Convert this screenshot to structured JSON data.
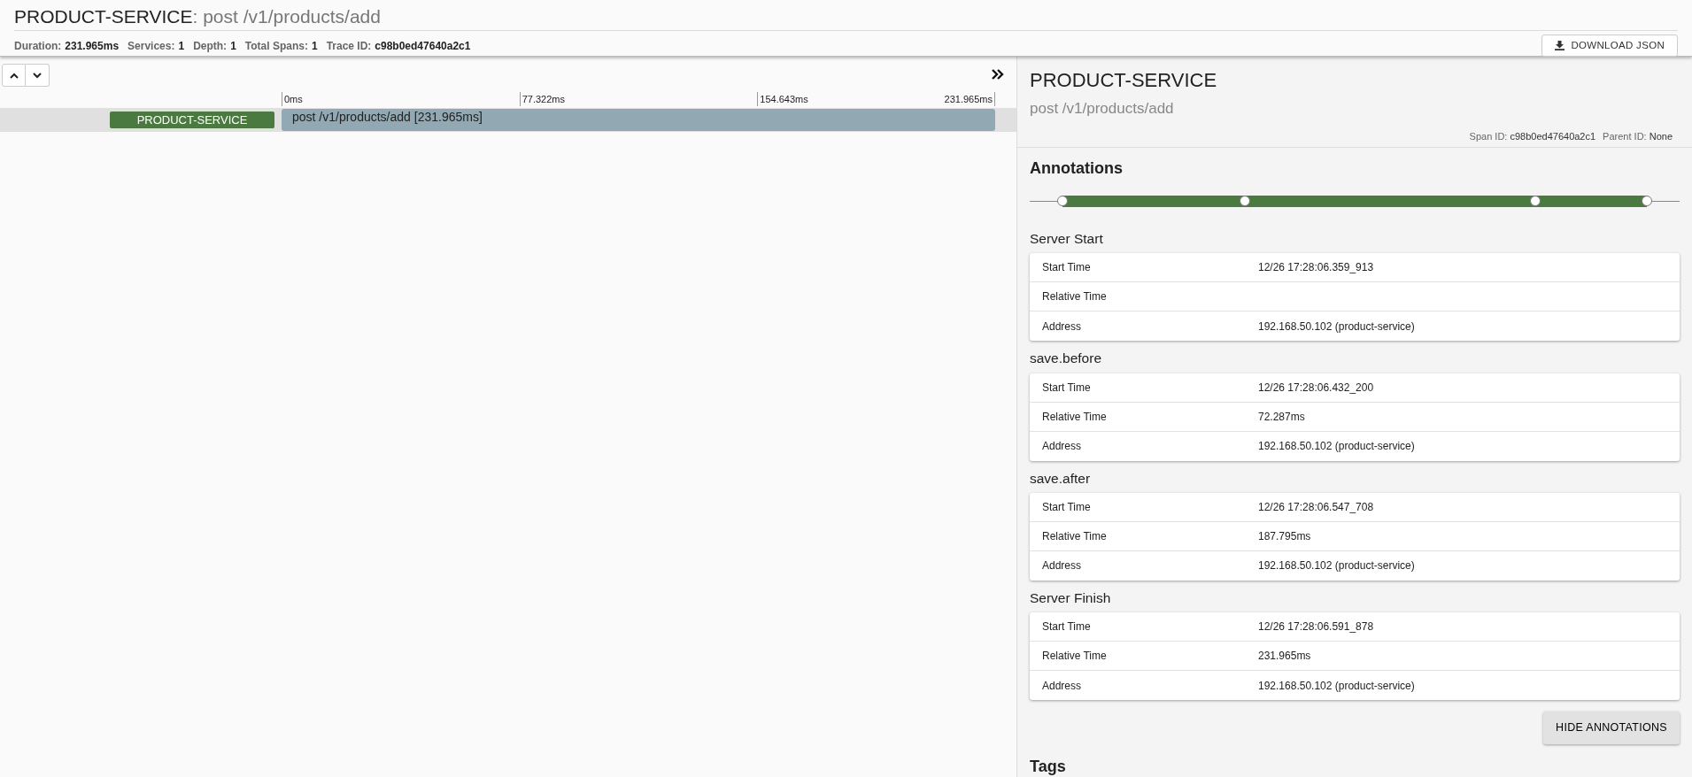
{
  "header": {
    "service": "PRODUCT-SERVICE",
    "separator": ": ",
    "operation": "post /v1/products/add",
    "stats": [
      {
        "label": "Duration:",
        "value": "231.965ms"
      },
      {
        "label": "Services:",
        "value": "1"
      },
      {
        "label": "Depth:",
        "value": "1"
      },
      {
        "label": "Total Spans:",
        "value": "1"
      },
      {
        "label": "Trace ID:",
        "value": "c98b0ed47640a2c1"
      }
    ],
    "download_button": "DOWNLOAD JSON"
  },
  "timeline": {
    "ticks": [
      "0ms",
      "77.322ms",
      "154.643ms",
      "231.965ms"
    ],
    "spans": [
      {
        "service": "PRODUCT-SERVICE",
        "label": "post /v1/products/add [231.965ms]",
        "selected": true
      }
    ]
  },
  "detail": {
    "service": "PRODUCT-SERVICE",
    "operation": "post /v1/products/add",
    "ids": [
      {
        "label": "Span ID:",
        "value": "c98b0ed47640a2c1"
      },
      {
        "label": "Parent ID:",
        "value": "None"
      }
    ],
    "annotations_title": "Annotations",
    "markers": [
      {
        "level": 0
      },
      {
        "level": 0.3116
      },
      {
        "level": 0.8096
      },
      {
        "level": 1
      }
    ],
    "annotations": [
      {
        "title": "Server Start",
        "rows": [
          {
            "label": "Start Time",
            "value": "12/26 17:28:06.359_913"
          },
          {
            "label": "Relative Time"
          },
          {
            "label": "Address",
            "value": "192.168.50.102 (product-service)"
          }
        ]
      },
      {
        "title": "save.before",
        "rows": [
          {
            "label": "Start Time",
            "value": "12/26 17:28:06.432_200"
          },
          {
            "label": "Relative Time",
            "value": "72.287ms"
          },
          {
            "label": "Address",
            "value": "192.168.50.102 (product-service)"
          }
        ]
      },
      {
        "title": "save.after",
        "rows": [
          {
            "label": "Start Time",
            "value": "12/26 17:28:06.547_708"
          },
          {
            "label": "Relative Time",
            "value": "187.795ms"
          },
          {
            "label": "Address",
            "value": "192.168.50.102 (product-service)"
          }
        ]
      },
      {
        "title": "Server Finish",
        "rows": [
          {
            "label": "Start Time",
            "value": "12/26 17:28:06.591_878"
          },
          {
            "label": "Relative Time",
            "value": "231.965ms"
          },
          {
            "label": "Address",
            "value": "192.168.50.102 (product-service)"
          }
        ]
      }
    ],
    "hide_button": "HIDE ANNOTATIONS",
    "tags_title": "Tags"
  }
}
